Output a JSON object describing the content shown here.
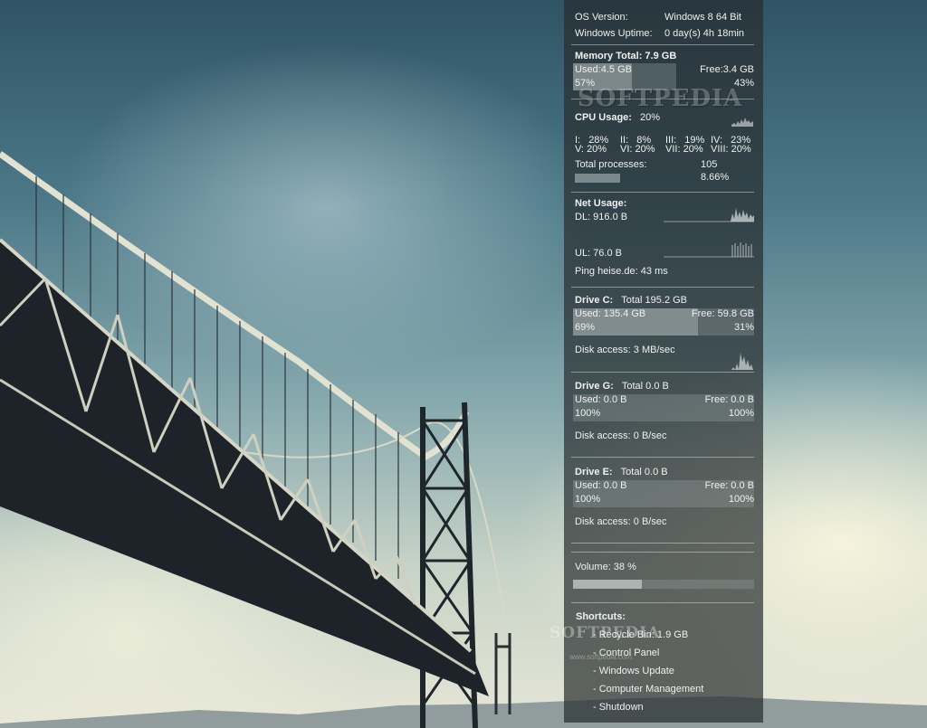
{
  "os": {
    "version_label": "OS Version:",
    "version_value": "Windows 8 64  Bit",
    "uptime_label": "Windows Uptime:",
    "uptime_value": "0 day(s) 4h 18min"
  },
  "memory": {
    "title": "Memory Total: 7.9 GB",
    "used": "Used:4.5 GB",
    "free": "Free:3.4 GB",
    "used_pct": "57%",
    "free_pct": "43%",
    "used_fraction": 0.57
  },
  "cpu": {
    "title_label": "CPU Usage:",
    "title_value": "20%",
    "cores": [
      {
        "label": "I:",
        "value": "28%"
      },
      {
        "label": "II:",
        "value": "8%"
      },
      {
        "label": "III:",
        "value": "19%"
      },
      {
        "label": "IV:",
        "value": "23%"
      },
      {
        "label": "V:",
        "value": "20%"
      },
      {
        "label": "VI:",
        "value": "20%"
      },
      {
        "label": "VII:",
        "value": "20%"
      },
      {
        "label": "VIII:",
        "value": "20%"
      }
    ],
    "processes_label": "Total processes:",
    "processes_value": "105",
    "processes_pct": "8.66%"
  },
  "net": {
    "title": "Net Usage:",
    "dl": "DL: 916.0 B",
    "ul": "UL: 76.0 B",
    "ping": "Ping heise.de: 43 ms"
  },
  "drives": [
    {
      "title_label": "Drive C:",
      "title_total": "Total 195.2 GB",
      "used": "Used: 135.4 GB",
      "free": "Free: 59.8 GB",
      "used_pct": "69%",
      "free_pct": "31%",
      "used_fraction": 0.69,
      "access": "Disk access: 3 MB/sec"
    },
    {
      "title_label": "Drive G:",
      "title_total": "Total 0.0 B",
      "used": "Used: 0.0 B",
      "free": "Free: 0.0 B",
      "used_pct": "100%",
      "free_pct": "100%",
      "used_fraction": 0,
      "access": "Disk access: 0 B/sec"
    },
    {
      "title_label": "Drive E:",
      "title_total": "Total 0.0 B",
      "used": "Used: 0.0 B",
      "free": "Free: 0.0 B",
      "used_pct": "100%",
      "free_pct": "100%",
      "used_fraction": 0,
      "access": "Disk access: 0 B/sec"
    }
  ],
  "volume": {
    "label": "Volume: 38 %",
    "fraction": 0.38
  },
  "shortcuts": {
    "title": "Shortcuts:",
    "items": [
      "- Recycle Bin: 1.9 GB",
      "- Control Panel",
      "- Windows Update",
      "- Computer Management",
      "- Shutdown"
    ]
  },
  "watermarks": {
    "main": "SOFTPEDIA",
    "small": "SOFTPEDIA",
    "url": "www.softpedia.com"
  },
  "colors": {
    "panel": "#262c2e",
    "text": "#f0f0f0",
    "bar": "#9aa4a4"
  }
}
